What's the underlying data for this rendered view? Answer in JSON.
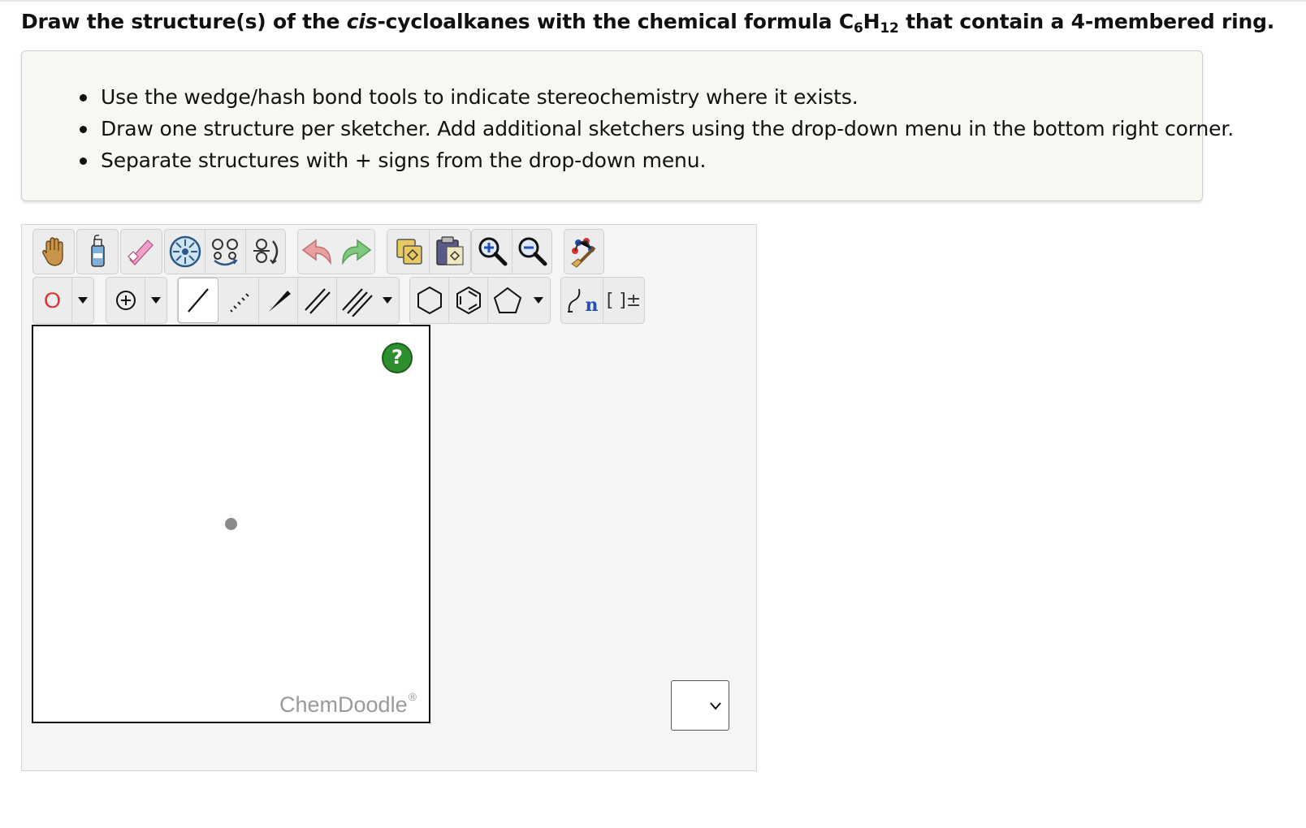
{
  "question": {
    "prefix": "Draw the structure(s) of the ",
    "italic": "cis",
    "middle": "-cycloalkanes with the chemical formula C",
    "sub1": "6",
    "h": "H",
    "sub2": "12",
    "suffix": " that contain a 4-membered ring."
  },
  "instructions": [
    "Use the wedge/hash bond tools to indicate stereochemistry where it exists.",
    "Draw one structure per sketcher. Add additional sketchers using the drop-down menu in the bottom right corner.",
    "Separate structures with + signs from the drop-down menu."
  ],
  "toolbar_row1": [
    {
      "icon": "hand-icon",
      "tooltip": ""
    },
    {
      "icon": "clear-bottle-icon",
      "tooltip": ""
    },
    {
      "icon": "eraser-icon",
      "tooltip": ""
    },
    {
      "icon": "center-icon",
      "tooltip": ""
    },
    {
      "icon": "flip-icon",
      "tooltip": ""
    },
    {
      "icon": "rotate-icon",
      "tooltip": ""
    },
    {
      "icon": "undo-icon",
      "tooltip": ""
    },
    {
      "icon": "redo-icon",
      "tooltip": ""
    },
    {
      "icon": "copy-icon",
      "tooltip": ""
    },
    {
      "icon": "paste-icon",
      "tooltip": ""
    },
    {
      "icon": "zoom-in-icon",
      "tooltip": ""
    },
    {
      "icon": "zoom-out-icon",
      "tooltip": ""
    },
    {
      "icon": "clean-icon",
      "tooltip": ""
    }
  ],
  "toolbar_row2": {
    "atom_label": "O",
    "charge_label": "⊕",
    "selected_tool": "single-bond",
    "text_label_n": "n",
    "bracket_label": "[ ]±"
  },
  "canvas": {
    "help_label": "?",
    "brand": "ChemDoodle",
    "brand_mark": "®"
  },
  "colors": {
    "atom_red": "#e03030",
    "help_green": "#2e8f2e",
    "undo_pink": "#e8a0a0",
    "redo_green": "#80c880",
    "accent_blue": "#2050c0"
  },
  "sketcher_dropdown": {
    "value": ""
  }
}
